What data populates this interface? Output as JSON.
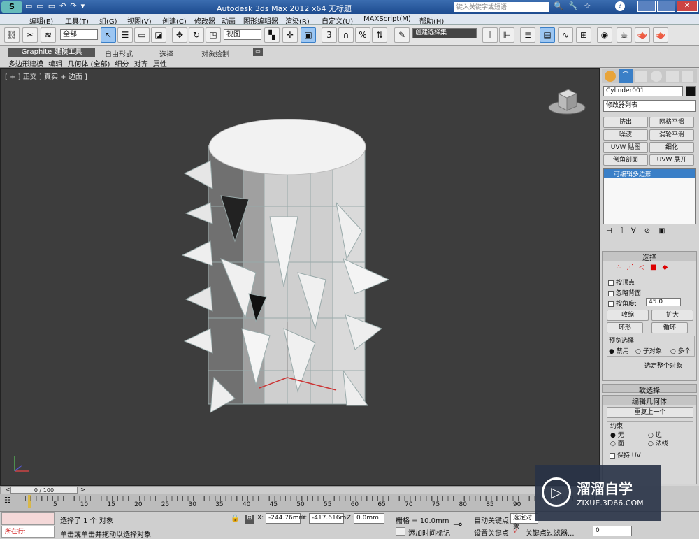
{
  "window": {
    "title": "Autodesk 3ds Max  2012 x64      无标题",
    "search_placeholder": "键入关键字或短语"
  },
  "menu": [
    "编辑(E)",
    "工具(T)",
    "组(G)",
    "视图(V)",
    "创建(C)",
    "修改器",
    "动画",
    "图形编辑器",
    "渲染(R)",
    "自定义(U)",
    "MAXScript(M)",
    "帮助(H)"
  ],
  "toolbar": {
    "selection_filter": "全部",
    "reference_coord": "视图",
    "named_selection": "创建选择集"
  },
  "ribbon": {
    "tabs": [
      "Graphite 建模工具",
      "自由形式",
      "选择",
      "对象绘制"
    ],
    "subtabs": [
      "多边形建模",
      "编辑",
      "几何体 (全部)",
      "细分",
      "对齐",
      "属性"
    ]
  },
  "viewport": {
    "label": "[ + ] 正交 ] 真实 + 边面 ]"
  },
  "panel": {
    "object_name": "Cylinder001",
    "modifier_list": "修改器列表",
    "modifier_buttons": [
      "挤出",
      "网格平滑",
      "噪波",
      "涡轮平滑",
      "UVW 贴图",
      "细化",
      "倒角剖面",
      "UVW 展开"
    ],
    "stack_item": "可编辑多边形",
    "selection": {
      "title": "选择",
      "by_vertex": "按顶点",
      "ignore_backface": "忽略背面",
      "by_angle": "按角度:",
      "angle_value": "45.0",
      "shrink": "收缩",
      "grow": "扩大",
      "ring": "环形",
      "loop": "循环",
      "preview_title": "预览选择",
      "preview_options": [
        "禁用",
        "子对象",
        "多个"
      ],
      "whole_object": "选定整个对象"
    },
    "soft_selection": "软选择",
    "edit_geometry": {
      "title": "编辑几何体",
      "repeat_last": "重复上一个",
      "constraints_title": "约束",
      "constraints": [
        "无",
        "边",
        "面",
        "法线"
      ],
      "preserve_uv": "保持 UV"
    }
  },
  "timeline": {
    "frame": "0 / 100",
    "ticks": [
      "5",
      "10",
      "15",
      "20",
      "25",
      "30",
      "35",
      "40",
      "45",
      "50",
      "55",
      "60",
      "65",
      "70",
      "75",
      "80",
      "85",
      "90"
    ]
  },
  "status": {
    "now_label": "所在行:",
    "message1": "选择了 1 个 对象",
    "message2": "单击或单击并拖动以选择对象",
    "x_label": "X:",
    "x": "-244.76mm",
    "y_label": "Y:",
    "y": "-417.616m",
    "z_label": "Z:",
    "z": "0.0mm",
    "grid": "栅格 = 10.0mm",
    "auto_key": "自动关键点",
    "selected": "选定对象",
    "set_key": "设置关键点",
    "key_filters": "关键点过滤器...",
    "add_time_tag": "添加时间标记",
    "frame_field": "0"
  },
  "watermark": {
    "name": "溜溜自学",
    "url": "ZIXUE.3D66.COM"
  }
}
